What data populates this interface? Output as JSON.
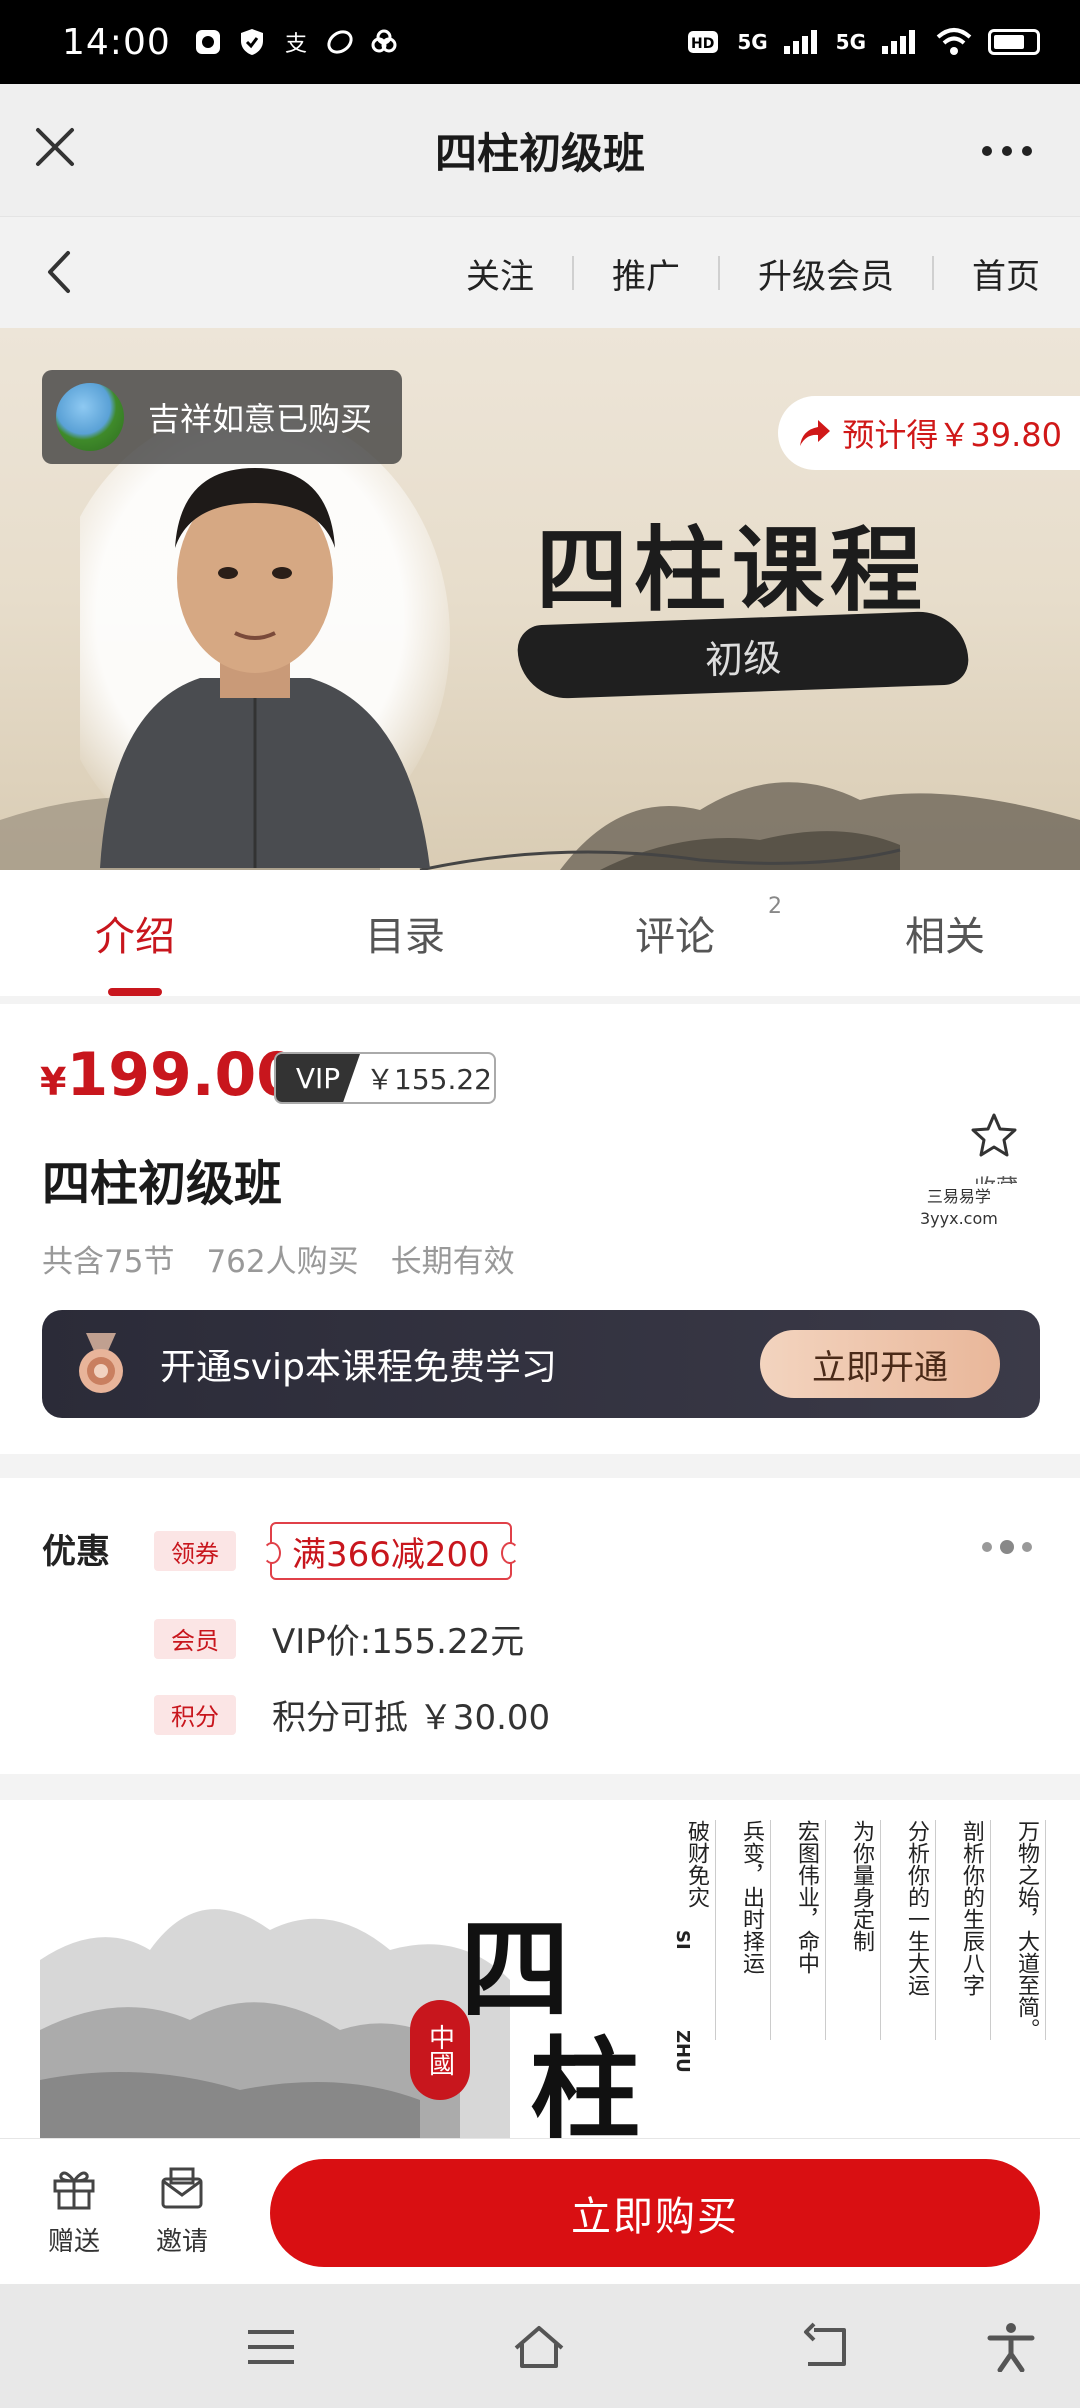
{
  "status": {
    "time": "14:00",
    "net1": "5G",
    "net2": "5G"
  },
  "titlebar": {
    "title": "四柱初级班"
  },
  "nav": {
    "links": [
      "关注",
      "推广",
      "升级会员",
      "首页"
    ]
  },
  "banner": {
    "buyer_text": "吉祥如意已购买",
    "earn_text": "预计得￥39.80",
    "course_title": "四柱课程",
    "course_level": "初级"
  },
  "tabs": [
    {
      "label": "介绍"
    },
    {
      "label": "目录"
    },
    {
      "label": "评论",
      "badge": "2"
    },
    {
      "label": "相关"
    }
  ],
  "product": {
    "currency": "¥",
    "price": "199.00",
    "vip_tag": "VIP",
    "vip_price": "￥155.22",
    "name": "四柱初级班",
    "favorite_label": "收藏",
    "meta": [
      "共含75节",
      "762人购买",
      "长期有效"
    ],
    "watermark_line1": "三易易学",
    "watermark_line2": "3yyx.com",
    "svip_text": "开通svip本课程免费学习",
    "svip_button": "立即开通"
  },
  "discount": {
    "label": "优惠",
    "coupon_tag": "领券",
    "coupon_text": "满366减200",
    "member_tag": "会员",
    "member_text": "VIP价:155.22元",
    "points_tag": "积分",
    "points_text": "积分可抵 ￥30.00"
  },
  "poster": {
    "char1": "四",
    "char2": "柱",
    "seal": "中國",
    "pinyin1": "SI",
    "pinyin2": "ZHU",
    "columns": [
      "万物之始，大道至简。",
      "剖析你的生辰八字",
      "分析你的一生大运",
      "为你量身定制",
      "宏图伟业，命中",
      "兵变，出时择运",
      "破财免灾"
    ]
  },
  "actions": {
    "gift": "赠送",
    "invite": "邀请",
    "buy": "立即购买"
  }
}
